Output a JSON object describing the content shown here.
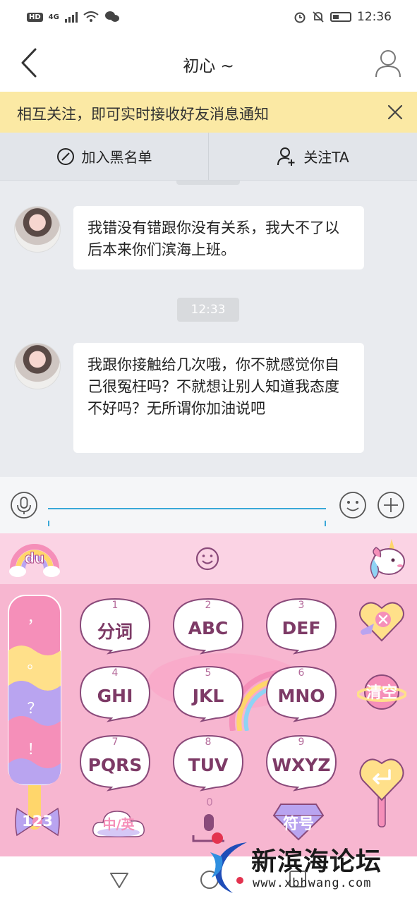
{
  "status_bar": {
    "hd": "HD",
    "network": "4G",
    "time": "12:36"
  },
  "header": {
    "title": "初心 ~",
    "back_icon": "chevron-left-icon",
    "profile_icon": "person-icon"
  },
  "notice": {
    "text": "相互关注，即可实时接收好友消息通知",
    "close_icon": "close-icon",
    "background": "#fbe9a4"
  },
  "actions": {
    "blacklist_label": "加入黑名单",
    "follow_label": "关注TA"
  },
  "messages": [
    {
      "text": "我错没有错跟你没有关系，我大不了以后本来你们滨海上班。"
    },
    {
      "text": "我跟你接触给几次哦，你不就感觉你自己很冤枉吗？不就想让别人知道我态度不好吗？无所谓你加油说吧"
    }
  ],
  "time_separator": "12:33",
  "input": {
    "value": "",
    "placeholder": ""
  },
  "keyboard": {
    "punctuation": [
      "，",
      "。",
      "？",
      "！"
    ],
    "keys": [
      {
        "num": "1",
        "label": "分词"
      },
      {
        "num": "2",
        "label": "ABC"
      },
      {
        "num": "3",
        "label": "DEF"
      },
      {
        "num": "4",
        "label": "GHI"
      },
      {
        "num": "5",
        "label": "JKL"
      },
      {
        "num": "6",
        "label": "MNO"
      },
      {
        "num": "7",
        "label": "PQRS"
      },
      {
        "num": "8",
        "label": "TUV"
      },
      {
        "num": "9",
        "label": "WXYZ"
      }
    ],
    "delete_icon": "backspace-heart-icon",
    "clear_label": "清空",
    "enter_icon": "enter-heart-icon",
    "num_mode_label": "123",
    "lang_label": "中/英",
    "zero": "0",
    "symbol_label": "符号",
    "logo_label": "du",
    "accent": "#f7b6d0",
    "key_text_color": "#7d3a66"
  },
  "watermark": {
    "title": "新滨海论坛",
    "url": "www.xbhwang.com"
  }
}
